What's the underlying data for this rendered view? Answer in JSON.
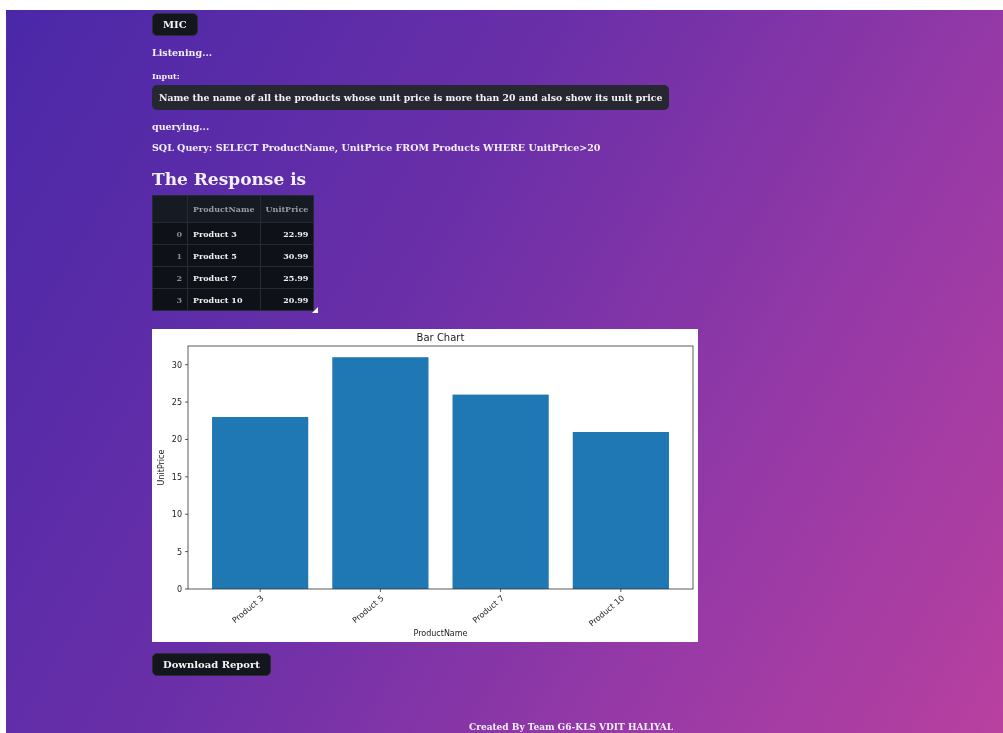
{
  "mic_button": {
    "label": "MIC"
  },
  "status": "Listening...",
  "input": {
    "label": "Input:",
    "value": "Name the name of all the products whose unit price is more than 20 and also show its unit price"
  },
  "progress": "querying...",
  "sql_query": "SQL Query: SELECT ProductName, UnitPrice FROM Products WHERE UnitPrice>20",
  "heading": "The Response is",
  "table": {
    "columns": [
      "ProductName",
      "UnitPrice"
    ],
    "rows": [
      {
        "index": "0",
        "cells": [
          "Product 3",
          "22.99"
        ]
      },
      {
        "index": "1",
        "cells": [
          "Product 5",
          "30.99"
        ]
      },
      {
        "index": "2",
        "cells": [
          "Product 7",
          "25.99"
        ]
      },
      {
        "index": "3",
        "cells": [
          "Product 10",
          "20.99"
        ]
      }
    ]
  },
  "chart": {
    "chart_data": {
      "type": "bar",
      "title": "Bar Chart",
      "xlabel": "ProductName",
      "ylabel": "UnitPrice",
      "categories": [
        "Product 3",
        "Product 5",
        "Product 7",
        "Product 10"
      ],
      "series": [
        {
          "color": "#1f77b4",
          "values": [
            23,
            31,
            26,
            21
          ]
        }
      ],
      "ylim": [
        0,
        32.5
      ],
      "yticks": [
        0,
        5,
        10,
        15,
        20,
        25,
        30
      ]
    }
  },
  "download_button": {
    "label": "Download Report"
  },
  "footer": "Created By Team G6-KLS VDIT HALIYAL"
}
